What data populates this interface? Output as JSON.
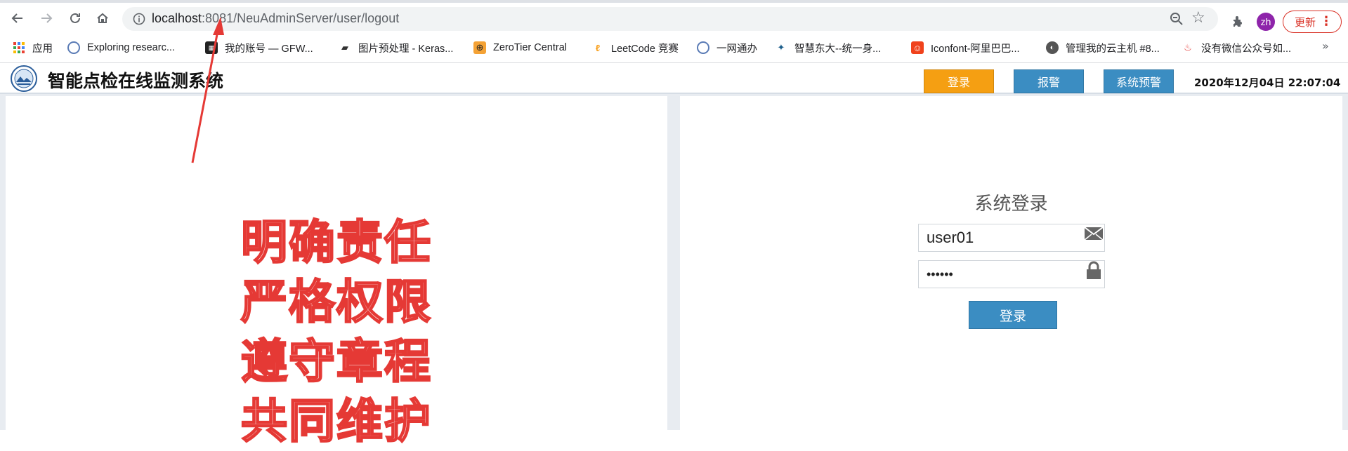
{
  "browser": {
    "url_host": "localhost",
    "url_rest": ":8081/NeuAdminServer/user/logout",
    "profile_initials": "zh",
    "update_label": "更新",
    "bookmarks": [
      {
        "label": "应用",
        "icon": "apps-grid-icon"
      },
      {
        "label": "Exploring researc...",
        "icon": "globe-icon"
      },
      {
        "label": "我的账号 — GFW...",
        "icon": "gfw-icon"
      },
      {
        "label": "图片预处理 - Keras...",
        "icon": "book-icon"
      },
      {
        "label": "ZeroTier Central",
        "icon": "zerotier-icon"
      },
      {
        "label": "LeetCode 竞赛",
        "icon": "leetcode-icon"
      },
      {
        "label": "一网通办",
        "icon": "globe-icon"
      },
      {
        "label": "智慧东大--统一身...",
        "icon": "compass-icon"
      },
      {
        "label": "Iconfont-阿里巴巴...",
        "icon": "iconfont-icon"
      },
      {
        "label": "管理我的云主机 #8...",
        "icon": "globe-dark-icon"
      },
      {
        "label": "没有微信公众号如...",
        "icon": "flame-icon"
      }
    ],
    "more": "»"
  },
  "app": {
    "title": "智能点检在线监测系统",
    "buttons": {
      "login": "登录",
      "alarm": "报警",
      "warning": "系统预警"
    },
    "datetime": "2020年12月04日 22:07:04",
    "colors": {
      "login": "#f59f12",
      "blue": "#3b8dc2",
      "slogan": "#e53935"
    }
  },
  "slogan": [
    "明确责任",
    "严格权限",
    "遵守章程",
    "共同维护"
  ],
  "login_form": {
    "title": "系统登录",
    "username_value": "user01",
    "password_value": "••••••",
    "submit_label": "登录"
  }
}
